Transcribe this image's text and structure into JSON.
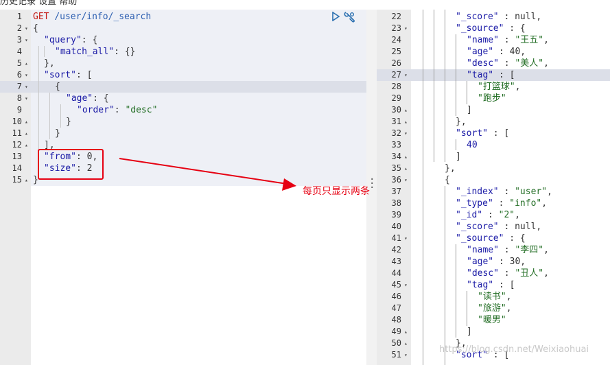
{
  "menubar": {
    "text": "历史记录  设置  帮助"
  },
  "request": {
    "method": "GET",
    "path": "/user/info/_search",
    "lines": [
      {
        "n": "1",
        "fold": ""
      },
      {
        "n": "2",
        "fold": "▾"
      },
      {
        "n": "3",
        "fold": "▾"
      },
      {
        "n": "4",
        "fold": ""
      },
      {
        "n": "5",
        "fold": "▴"
      },
      {
        "n": "6",
        "fold": "▾"
      },
      {
        "n": "7",
        "fold": "▾"
      },
      {
        "n": "8",
        "fold": "▾"
      },
      {
        "n": "9",
        "fold": ""
      },
      {
        "n": "10",
        "fold": "▴"
      },
      {
        "n": "11",
        "fold": "▴"
      },
      {
        "n": "12",
        "fold": "▴"
      },
      {
        "n": "13",
        "fold": ""
      },
      {
        "n": "14",
        "fold": ""
      },
      {
        "n": "15",
        "fold": "▴"
      }
    ],
    "code": {
      "l2": "{",
      "l3_key": "\"query\"",
      "l3_rest": ": {",
      "l4_key": "\"match_all\"",
      "l4_rest": ": {}",
      "l5": "},",
      "l6_key": "\"sort\"",
      "l6_rest": ": [",
      "l7": "{",
      "l8_key": "\"age\"",
      "l8_rest": ": {",
      "l9_key": "\"order\"",
      "l9_sep": ": ",
      "l9_val": "\"desc\"",
      "l10": "}",
      "l11": "}",
      "l12": "],",
      "l13_key": "\"from\"",
      "l13_rest": ": 0,",
      "l14_key": "\"size\"",
      "l14_rest": ": 2",
      "l15": "}"
    }
  },
  "toolbar": {
    "run_icon": "play-icon",
    "settings_icon": "wrench-icon"
  },
  "annotation": {
    "text": "每页只显示两条"
  },
  "response": {
    "lines": [
      {
        "n": "22",
        "fold": ""
      },
      {
        "n": "23",
        "fold": "▾"
      },
      {
        "n": "24",
        "fold": ""
      },
      {
        "n": "25",
        "fold": ""
      },
      {
        "n": "26",
        "fold": ""
      },
      {
        "n": "27",
        "fold": "▾"
      },
      {
        "n": "28",
        "fold": ""
      },
      {
        "n": "29",
        "fold": ""
      },
      {
        "n": "30",
        "fold": "▴"
      },
      {
        "n": "31",
        "fold": "▴"
      },
      {
        "n": "32",
        "fold": "▾"
      },
      {
        "n": "33",
        "fold": ""
      },
      {
        "n": "34",
        "fold": "▴"
      },
      {
        "n": "35",
        "fold": "▴"
      },
      {
        "n": "36",
        "fold": "▾"
      },
      {
        "n": "37",
        "fold": ""
      },
      {
        "n": "38",
        "fold": ""
      },
      {
        "n": "39",
        "fold": ""
      },
      {
        "n": "40",
        "fold": ""
      },
      {
        "n": "41",
        "fold": "▾"
      },
      {
        "n": "42",
        "fold": ""
      },
      {
        "n": "43",
        "fold": ""
      },
      {
        "n": "44",
        "fold": ""
      },
      {
        "n": "45",
        "fold": "▾"
      },
      {
        "n": "46",
        "fold": ""
      },
      {
        "n": "47",
        "fold": ""
      },
      {
        "n": "48",
        "fold": ""
      },
      {
        "n": "49",
        "fold": "▴"
      },
      {
        "n": "50",
        "fold": "▴"
      },
      {
        "n": "51",
        "fold": "▾"
      }
    ],
    "code": {
      "r22_key": "\"_score\"",
      "r22_rest": " : null,",
      "r23_key": "\"_source\"",
      "r23_rest": " : {",
      "r24_key": "\"name\"",
      "r24_sep": " : ",
      "r24_val": "\"王五\"",
      "r24_end": ",",
      "r25_key": "\"age\"",
      "r25_rest": " : 40,",
      "r26_key": "\"desc\"",
      "r26_sep": " : ",
      "r26_val": "\"美人\"",
      "r26_end": ",",
      "r27_key": "\"tag\"",
      "r27_rest": " : [",
      "r28_val": "\"打篮球\"",
      "r28_end": ",",
      "r29_val": "\"跑步\"",
      "r30": "]",
      "r31": "},",
      "r32_key": "\"sort\"",
      "r32_rest": " : [",
      "r33": "40",
      "r34": "]",
      "r35": "},",
      "r36": "{",
      "r37_key": "\"_index\"",
      "r37_sep": " : ",
      "r37_val": "\"user\"",
      "r37_end": ",",
      "r38_key": "\"_type\"",
      "r38_sep": " : ",
      "r38_val": "\"info\"",
      "r38_end": ",",
      "r39_key": "\"_id\"",
      "r39_sep": " : ",
      "r39_val": "\"2\"",
      "r39_end": ",",
      "r40_key": "\"_score\"",
      "r40_rest": " : null,",
      "r41_key": "\"_source\"",
      "r41_rest": " : {",
      "r42_key": "\"name\"",
      "r42_sep": " : ",
      "r42_val": "\"李四\"",
      "r42_end": ",",
      "r43_key": "\"age\"",
      "r43_rest": " : 30,",
      "r44_key": "\"desc\"",
      "r44_sep": " : ",
      "r44_val": "\"丑人\"",
      "r44_end": ",",
      "r45_key": "\"tag\"",
      "r45_rest": " : [",
      "r46_val": "\"读书\"",
      "r46_end": ",",
      "r47_val": "\"旅游\"",
      "r47_end": ",",
      "r48_val": "\"暖男\"",
      "r49": "]",
      "r50": "},",
      "r51_key": "\"sort\"",
      "r51_rest": " : ["
    }
  },
  "watermark": "https://blog.csdn.net/Weixiaohuai",
  "colors": {
    "annotation": "#e60012",
    "key": "#1a1aa6",
    "string": "#236e25",
    "method": "#c41a16"
  }
}
